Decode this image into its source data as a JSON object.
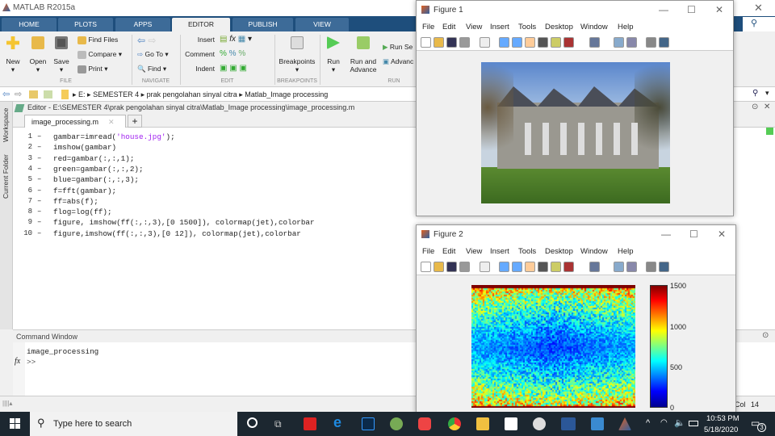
{
  "app": {
    "title": "MATLAB R2015a"
  },
  "tabs": [
    "HOME",
    "PLOTS",
    "APPS",
    "EDITOR",
    "PUBLISH",
    "VIEW"
  ],
  "toolstrip": {
    "file": {
      "new": "New",
      "open": "Open",
      "save": "Save",
      "find_files": "Find Files",
      "compare": "Compare",
      "print": "Print",
      "section": "FILE"
    },
    "navigate": {
      "go_to": "Go To",
      "find": "Find",
      "section": "NAVIGATE"
    },
    "edit": {
      "insert": "Insert",
      "comment": "Comment",
      "indent": "Indent",
      "section": "EDIT"
    },
    "breakpoints": {
      "label": "Breakpoints",
      "section": "BREAKPOINTS"
    },
    "run": {
      "run": "Run",
      "run_advance": "Run and Advance",
      "run_section": "Run Se",
      "advance": "Advanc",
      "section": "RUN"
    }
  },
  "address": [
    "E:",
    "SEMESTER 4",
    "prak pengolahan sinyal citra",
    "Matlab_Image processing"
  ],
  "editor": {
    "title": "Editor - E:\\SEMESTER 4\\prak pengolahan sinyal citra\\Matlab_Image processing\\image_processing.m",
    "tab": "image_processing.m",
    "lines": [
      {
        "n": "1",
        "pre": "gambar=imread(",
        "str": "'house.jpg'",
        "post": ");"
      },
      {
        "n": "2",
        "pre": "imshow(gambar)",
        "str": "",
        "post": ""
      },
      {
        "n": "3",
        "pre": "red=gambar(:,:,1);",
        "str": "",
        "post": ""
      },
      {
        "n": "4",
        "pre": "green=gambar(:,:,2);",
        "str": "",
        "post": ""
      },
      {
        "n": "5",
        "pre": "blue=gambar(:,:,3);",
        "str": "",
        "post": ""
      },
      {
        "n": "6",
        "pre": "f=fft(gambar);",
        "str": "",
        "post": ""
      },
      {
        "n": "7",
        "pre": "ff=abs(f);",
        "str": "",
        "post": ""
      },
      {
        "n": "8",
        "pre": "flog=log(ff);",
        "str": "",
        "post": ""
      },
      {
        "n": "9",
        "pre": "figure, imshow(ff(:,:,3),[0 1500]), colormap(jet),colorbar",
        "str": "",
        "post": ""
      },
      {
        "n": "10",
        "pre": "figure,imshow(ff(:,:,3),[0 12]), colormap(jet),colorbar",
        "str": "",
        "post": ""
      }
    ]
  },
  "side": {
    "workspace": "Workspace",
    "current_folder": "Current Folder"
  },
  "command": {
    "title": "Command Window",
    "output": "image_processing",
    "prompt": ">>",
    "fx": "fx"
  },
  "status": {
    "col_label": "Col",
    "col": "14"
  },
  "figure1": {
    "title": "Figure 1",
    "menu": [
      "File",
      "Edit",
      "View",
      "Insert",
      "Tools",
      "Desktop",
      "Window",
      "Help"
    ]
  },
  "figure2": {
    "title": "Figure 2",
    "menu": [
      "File",
      "Edit",
      "View",
      "Insert",
      "Tools",
      "Desktop",
      "Window",
      "Help"
    ],
    "colorbar_ticks": [
      "1500",
      "1000",
      "500",
      "0"
    ]
  },
  "taskbar": {
    "search_placeholder": "Type here to search",
    "time": "10:53 PM",
    "date": "5/18/2020",
    "notifications": "3"
  }
}
